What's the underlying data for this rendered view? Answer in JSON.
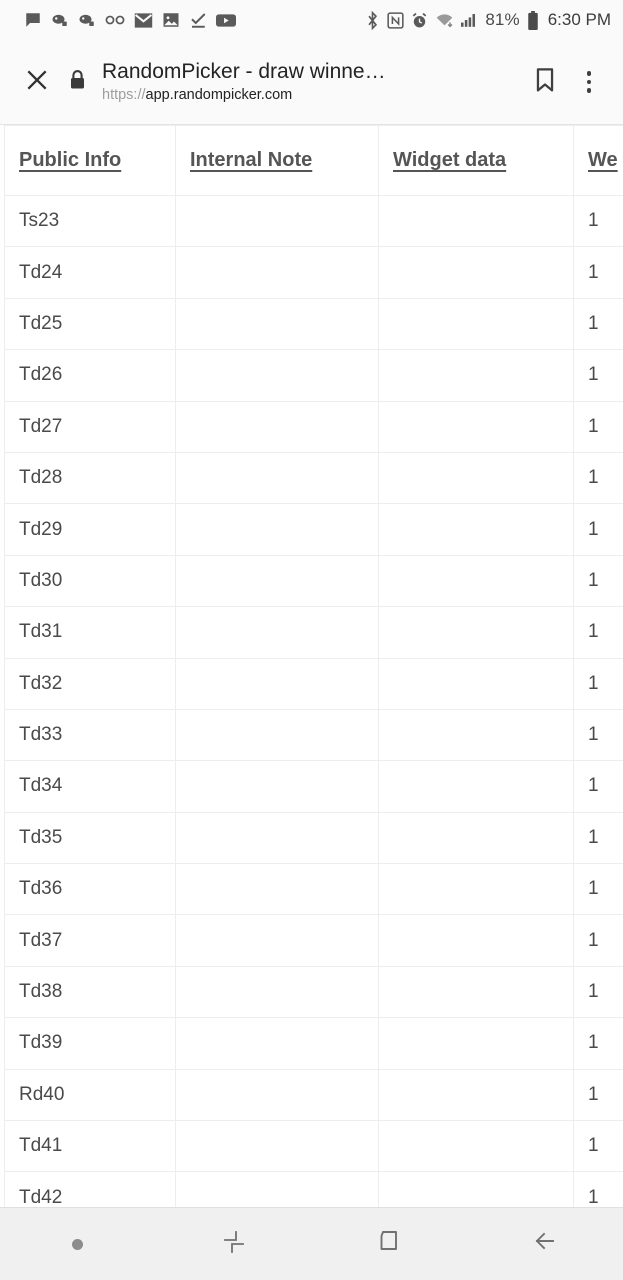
{
  "statusbar": {
    "notification_icons": [
      {
        "name": "message-icon",
        "label": "message"
      },
      {
        "name": "game-controller-icon",
        "label": "game"
      },
      {
        "name": "game-controller-2-icon",
        "label": "game"
      },
      {
        "name": "voicemail-icon",
        "label": "voicemail"
      },
      {
        "name": "mail-icon",
        "label": "mail"
      },
      {
        "name": "photo-icon",
        "label": "photo"
      },
      {
        "name": "checkmark-icon",
        "label": "task complete"
      },
      {
        "name": "youtube-icon",
        "label": "youtube"
      }
    ],
    "system_icons": [
      {
        "name": "bluetooth-icon",
        "label": "bluetooth"
      },
      {
        "name": "nfc-icon",
        "label": "nfc"
      },
      {
        "name": "alarm-icon",
        "label": "alarm"
      },
      {
        "name": "wifi-icon",
        "label": "wifi"
      },
      {
        "name": "cellular-signal-icon",
        "label": "signal"
      }
    ],
    "battery_percent": "81%",
    "time": "6:30 PM"
  },
  "toolbar": {
    "close_label": "Close",
    "security_icon": "lock-icon",
    "page_title": "RandomPicker - draw winne…",
    "url_scheme": "https://",
    "url_host": "app.randompicker.com",
    "bookmark_label": "Bookmark",
    "menu_label": "More options"
  },
  "table": {
    "columns": [
      "Public Info",
      "Internal Note",
      "Widget data",
      "We"
    ],
    "rows": [
      {
        "public_info": "Ts23",
        "internal_note": "",
        "widget_data": "",
        "we": "1"
      },
      {
        "public_info": "Td24",
        "internal_note": "",
        "widget_data": "",
        "we": "1"
      },
      {
        "public_info": "Td25",
        "internal_note": "",
        "widget_data": "",
        "we": "1"
      },
      {
        "public_info": "Td26",
        "internal_note": "",
        "widget_data": "",
        "we": "1"
      },
      {
        "public_info": "Td27",
        "internal_note": "",
        "widget_data": "",
        "we": "1"
      },
      {
        "public_info": "Td28",
        "internal_note": "",
        "widget_data": "",
        "we": "1"
      },
      {
        "public_info": "Td29",
        "internal_note": "",
        "widget_data": "",
        "we": "1"
      },
      {
        "public_info": "Td30",
        "internal_note": "",
        "widget_data": "",
        "we": "1"
      },
      {
        "public_info": "Td31",
        "internal_note": "",
        "widget_data": "",
        "we": "1"
      },
      {
        "public_info": "Td32",
        "internal_note": "",
        "widget_data": "",
        "we": "1"
      },
      {
        "public_info": "Td33",
        "internal_note": "",
        "widget_data": "",
        "we": "1"
      },
      {
        "public_info": "Td34",
        "internal_note": "",
        "widget_data": "",
        "we": "1"
      },
      {
        "public_info": "Td35",
        "internal_note": "",
        "widget_data": "",
        "we": "1"
      },
      {
        "public_info": "Td36",
        "internal_note": "",
        "widget_data": "",
        "we": "1"
      },
      {
        "public_info": "Td37",
        "internal_note": "",
        "widget_data": "",
        "we": "1"
      },
      {
        "public_info": "Td38",
        "internal_note": "",
        "widget_data": "",
        "we": "1"
      },
      {
        "public_info": "Td39",
        "internal_note": "",
        "widget_data": "",
        "we": "1"
      },
      {
        "public_info": "Rd40",
        "internal_note": "",
        "widget_data": "",
        "we": "1"
      },
      {
        "public_info": "Td41",
        "internal_note": "",
        "widget_data": "",
        "we": "1"
      },
      {
        "public_info": "Td42",
        "internal_note": "",
        "widget_data": "",
        "we": "1"
      }
    ]
  },
  "navbar": {
    "items": [
      {
        "name": "nav-dot",
        "label": ""
      },
      {
        "name": "recents-button",
        "label": "Recents"
      },
      {
        "name": "home-button",
        "label": "Home"
      },
      {
        "name": "back-button",
        "label": "Back"
      }
    ]
  },
  "colors": {
    "status_bar_bg": "#fafafa",
    "toolbar_bg": "#fafafa",
    "page_bg": "#ffffff",
    "grid_line": "#ededed",
    "header_text": "#555555",
    "cell_text": "#4a4a4a",
    "navbar_bg": "#f0f0f0"
  }
}
